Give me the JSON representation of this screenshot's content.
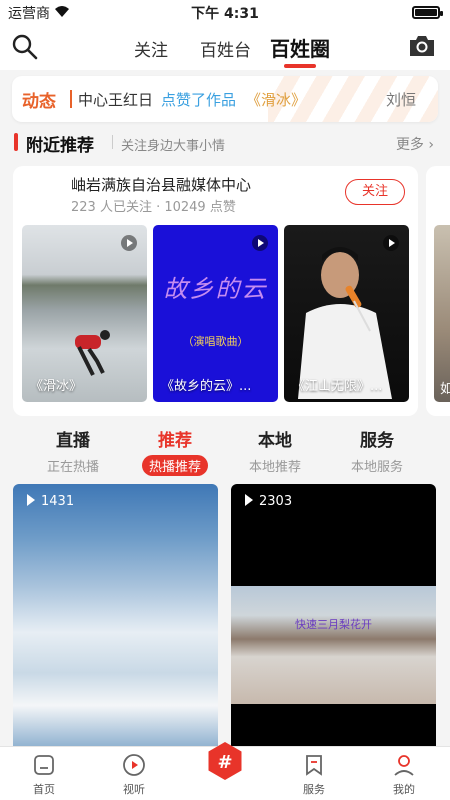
{
  "status_bar": {
    "carrier": "运营商",
    "time": "下午 4:31"
  },
  "top_nav": {
    "tabs": [
      {
        "label": "关注"
      },
      {
        "label": "百姓台"
      },
      {
        "label": "百姓圈"
      }
    ],
    "active_tab": "百姓圈"
  },
  "ticker": {
    "badge": "动态",
    "actor": "中心王红日",
    "action": "点赞了作品",
    "work": "《滑冰》",
    "next": "刘恒"
  },
  "nearby": {
    "title": "附近推荐",
    "subtitle": "关注身边大事小情",
    "more": "更多"
  },
  "creator_card": {
    "name": "岫岩满族自治县融媒体中心",
    "stats": "223 人已关注 · 10249 点赞",
    "follow_label": "关注",
    "videos": [
      {
        "caption": "《滑冰》"
      },
      {
        "caption": "《故乡的云》..."
      },
      {
        "caption": "《江山无限》..."
      }
    ],
    "slide_text": "故乡的云",
    "slide_subtext": "（演唱歌曲）",
    "peek_caption": "如"
  },
  "categories": [
    {
      "title": "直播",
      "subtitle": "正在热播"
    },
    {
      "title": "推荐",
      "subtitle": "热播推荐"
    },
    {
      "title": "本地",
      "subtitle": "本地推荐"
    },
    {
      "title": "服务",
      "subtitle": "本地服务"
    }
  ],
  "active_category": "推荐",
  "feed": [
    {
      "views": "1431"
    },
    {
      "views": "2303",
      "overlay_title": "快速三月梨花开"
    }
  ],
  "tab_bar": [
    {
      "label": "首页"
    },
    {
      "label": "视听"
    },
    {
      "label": "",
      "icon": "hashtag-icon"
    },
    {
      "label": "服务"
    },
    {
      "label": "我的"
    }
  ],
  "colors": {
    "accent": "#e8342a",
    "orange": "#e8622a",
    "link": "#3aa0e0"
  }
}
